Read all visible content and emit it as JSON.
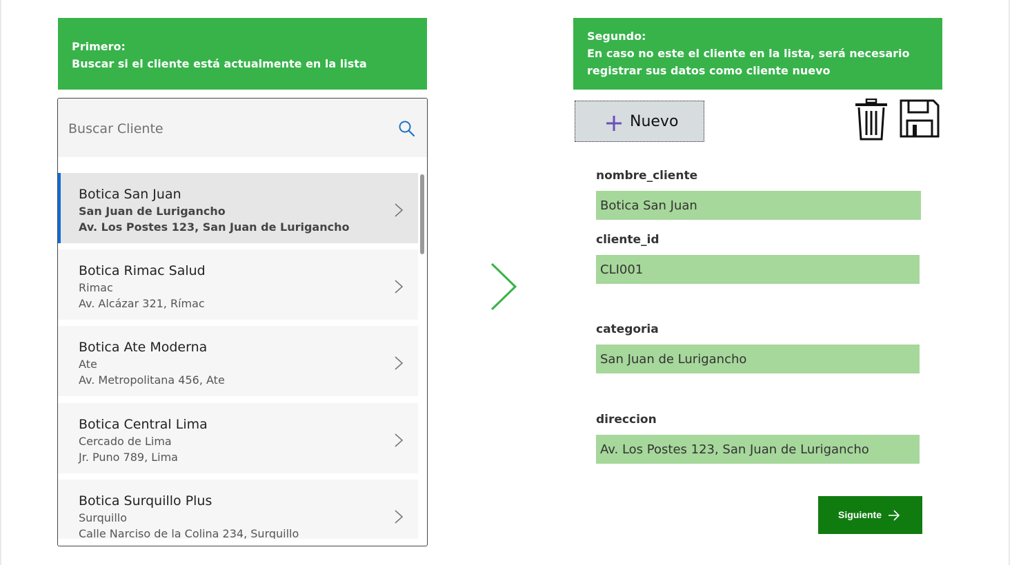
{
  "banners": {
    "left": {
      "line1": "Primero:",
      "line2": "Buscar si el cliente está actualmente en la lista"
    },
    "right": {
      "line1": "Segundo:",
      "line2": "En caso no este el cliente en la lista, será necesario",
      "line3": "registrar sus datos como cliente nuevo"
    }
  },
  "search": {
    "placeholder": "Buscar Cliente",
    "icon": "search-icon"
  },
  "clients": [
    {
      "title": "Botica San Juan",
      "subtitle": "San Juan de Lurigancho",
      "address": "Av. Los Postes 123, San Juan de Lurigancho",
      "selected": true
    },
    {
      "title": "Botica Rimac Salud",
      "subtitle": "Rimac",
      "address": "Av. Alcázar 321, Rímac"
    },
    {
      "title": "Botica Ate Moderna",
      "subtitle": "Ate",
      "address": "Av. Metropolitana 456, Ate"
    },
    {
      "title": "Botica Central Lima",
      "subtitle": "Cercado de Lima",
      "address": "Jr. Puno 789, Lima"
    },
    {
      "title": "Botica Surquillo Plus",
      "subtitle": "Surquillo",
      "address": "Calle Narciso de la Colina 234, Surquillo"
    }
  ],
  "toolbar": {
    "new_label": "Nuevo",
    "new_icon": "plus-icon",
    "delete_icon": "trash-icon",
    "save_icon": "save-icon"
  },
  "form": {
    "nombre_cliente": {
      "label": "nombre_cliente",
      "value": "Botica San Juan"
    },
    "cliente_id": {
      "label": "cliente_id",
      "value": "CLI001"
    },
    "categoria": {
      "label": "categoria",
      "value": "San Juan de Lurigancho"
    },
    "direccion": {
      "label": "direccion",
      "value": "Av. Los Postes 123, San Juan de Lurigancho"
    }
  },
  "next_button": {
    "label": "Siguiente",
    "icon": "arrow-right-icon"
  },
  "colors": {
    "banner": "#37b34a",
    "field_bg": "#a6d79b",
    "next_button": "#107c10",
    "selection_accent": "#0f6cd8",
    "plus_icon": "#6b4fbb"
  }
}
